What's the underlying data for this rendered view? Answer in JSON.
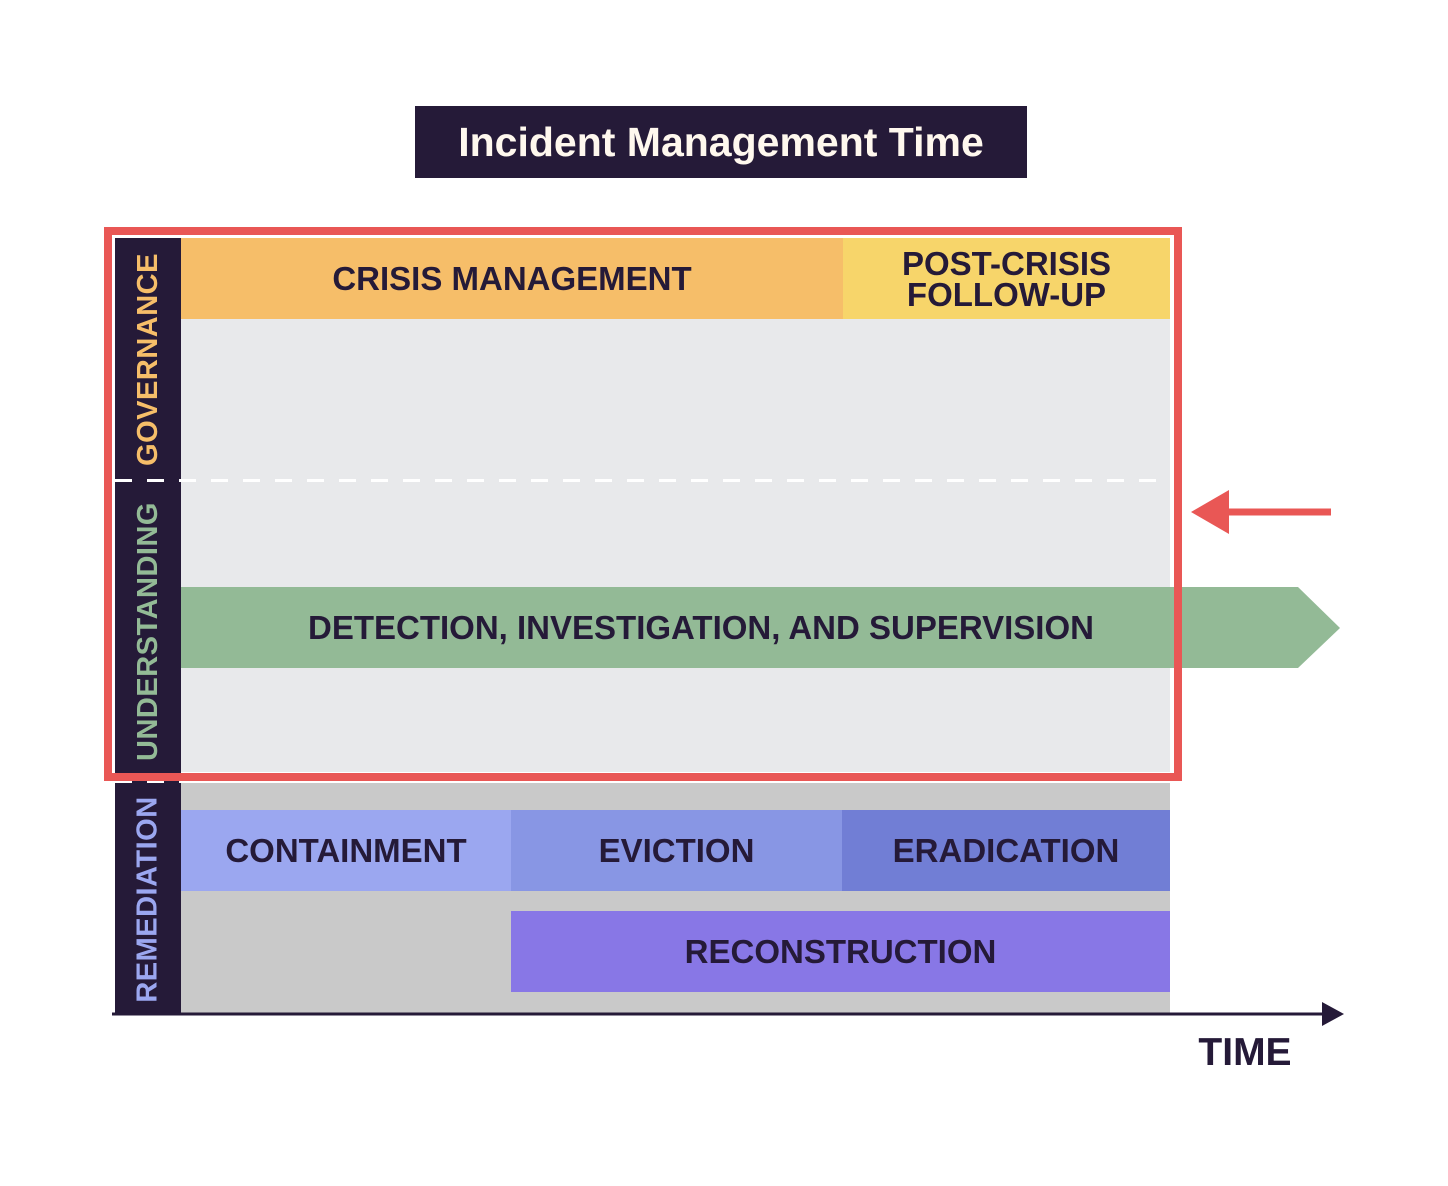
{
  "title": "Incident Management Time",
  "colors": {
    "dark": "#251A38",
    "frame_red": "#E95755",
    "crisis": "#F6BE69",
    "post_crisis": "#F7D56A",
    "detection": "#93BA96",
    "containment": "#9BA7F0",
    "eviction": "#8896E4",
    "eradication": "#717ED5",
    "reconstruction": "#8877E6",
    "governance_label": "#F6BE69",
    "understanding_label": "#93BA96",
    "remediation_label": "#9BA7F0"
  },
  "lanes": [
    {
      "label": "GOVERNANCE"
    },
    {
      "label": "UNDERSTANDING"
    },
    {
      "label": "REMEDIATION"
    }
  ],
  "phases": {
    "crisis_management": "CRISIS MANAGEMENT",
    "post_crisis_line1": "POST-CRISIS",
    "post_crisis_line2": "FOLLOW-UP",
    "detection": "DETECTION, INVESTIGATION, AND SUPERVISION",
    "containment": "CONTAINMENT",
    "eviction": "EVICTION",
    "eradication": "ERADICATION",
    "reconstruction": "RECONSTRUCTION"
  },
  "axis": {
    "label": "TIME"
  },
  "icons": {
    "highlight_arrow": "left-arrow-icon",
    "axis_arrow": "right-arrow-icon"
  }
}
